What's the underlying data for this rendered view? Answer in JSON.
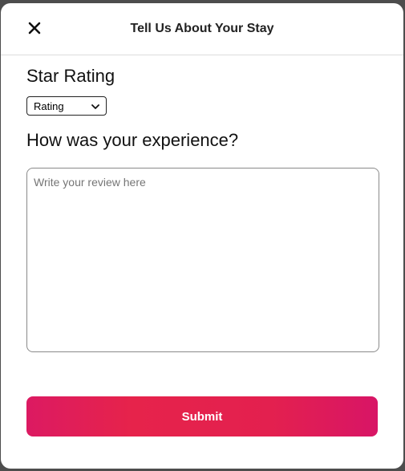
{
  "modal": {
    "title": "Tell Us About Your Stay",
    "close_icon": "close-icon"
  },
  "rating": {
    "heading": "Star Rating",
    "selected": "Rating",
    "chevron_icon": "chevron-down-icon"
  },
  "review": {
    "heading": "How was your experience?",
    "placeholder": "Write your review here",
    "value": ""
  },
  "actions": {
    "submit_label": "Submit"
  },
  "colors": {
    "accent": "#e31c5f",
    "border": "#dddddd",
    "backdrop": "#4d4d4d"
  }
}
